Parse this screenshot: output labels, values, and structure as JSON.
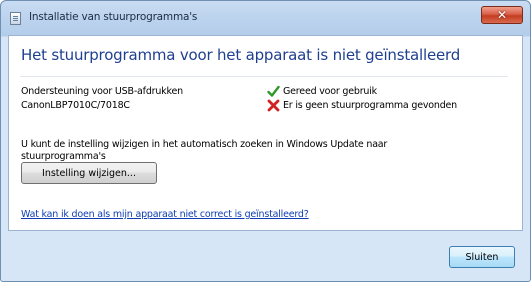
{
  "window": {
    "title": "Installatie van stuurprogramma's",
    "close_glyph": "✕"
  },
  "main": {
    "instruction": "Het stuurprogramma voor het apparaat is niet geïnstalleerd",
    "devices": [
      {
        "name": "Ondersteuning voor USB-afdrukken",
        "status": "Gereed voor gebruik",
        "status_icon": "check-icon",
        "status_color": "#2e9a2e"
      },
      {
        "name": "CanonLBP7010C/7018C",
        "status": "Er is geen stuurprogramma gevonden",
        "status_icon": "error-x-icon",
        "status_color": "#d32020"
      }
    ],
    "info_line1": "U kunt de instelling wijzigen in het automatisch zoeken in Windows Update naar",
    "info_line2": "stuurprogramma's",
    "change_button": "Instelling wijzigen...",
    "help_link": "Wat kan ik doen als mijn apparaat niet correct is geïnstalleerd?"
  },
  "footer": {
    "close_button": "Sluiten"
  }
}
